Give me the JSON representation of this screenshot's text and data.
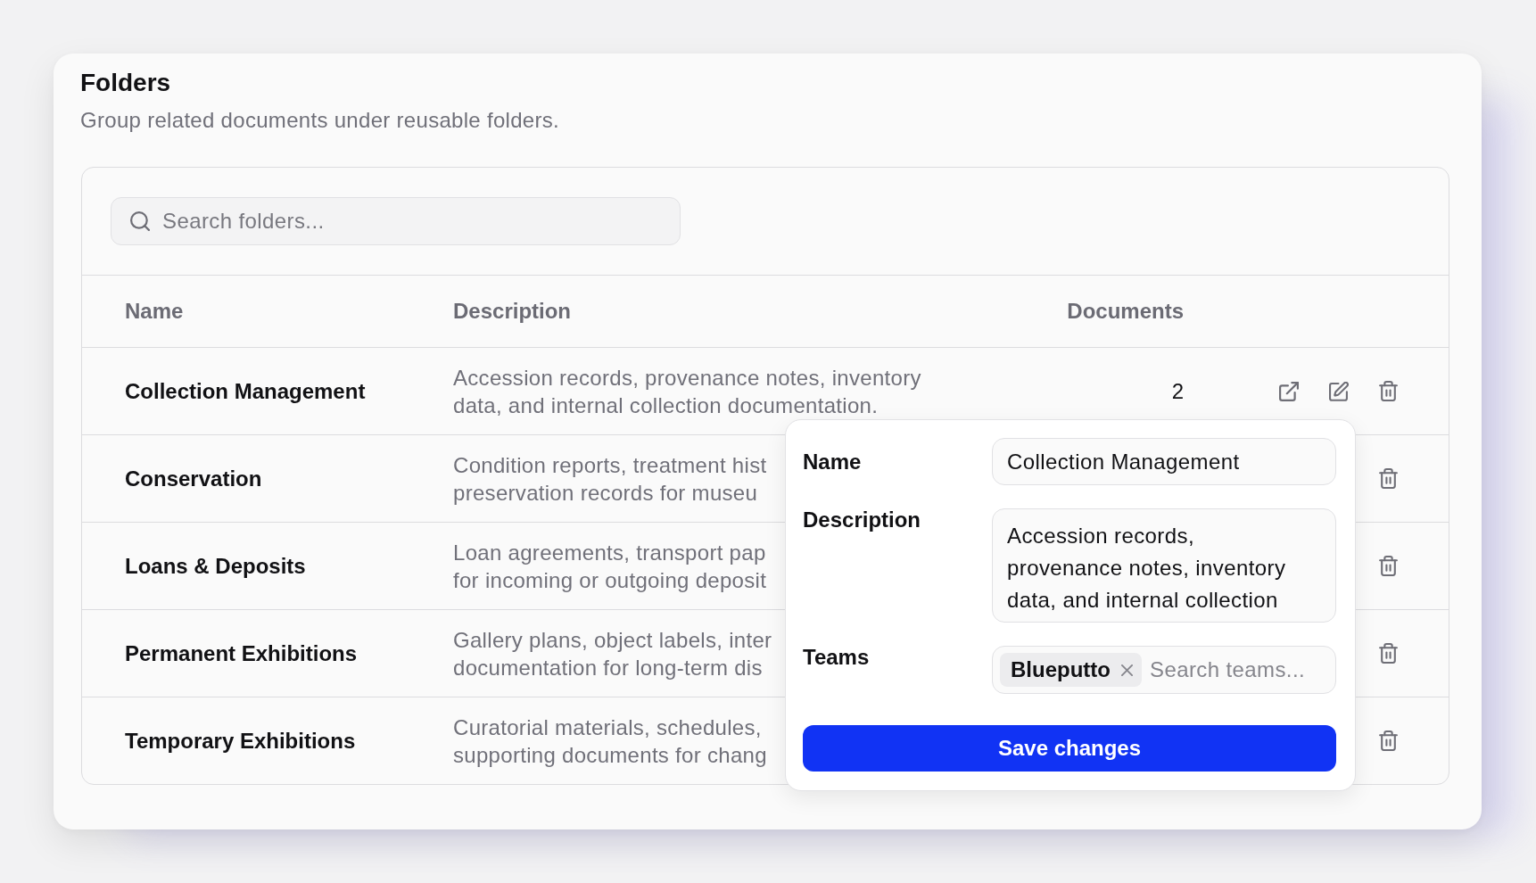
{
  "page": {
    "title": "Folders",
    "subtitle": "Group related documents under reusable folders."
  },
  "search": {
    "placeholder": "Search folders..."
  },
  "table": {
    "columns": [
      "Name",
      "Description",
      "Documents"
    ],
    "rows": [
      {
        "name": "Collection Management",
        "description": [
          "Accession records, provenance notes, inventory",
          "data, and internal collection documentation."
        ],
        "documents": "2",
        "actions": [
          {
            "kind": "open"
          },
          {
            "kind": "edit"
          },
          {
            "kind": "delete"
          }
        ]
      },
      {
        "name": "Conservation",
        "description": [
          "Condition reports, treatment hist",
          "preservation records for museu"
        ],
        "actions": [
          {
            "kind": "delete"
          }
        ]
      },
      {
        "name": "Loans & Deposits",
        "description": [
          "Loan agreements, transport pap",
          "for incoming or outgoing deposit"
        ],
        "actions": [
          {
            "kind": "delete"
          }
        ]
      },
      {
        "name": "Permanent Exhibitions",
        "description": [
          "Gallery plans, object labels, inter",
          "documentation for long-term dis"
        ],
        "actions": [
          {
            "kind": "delete"
          }
        ]
      },
      {
        "name": "Temporary Exhibitions",
        "description": [
          "Curatorial materials, schedules,",
          "supporting documents for chang"
        ],
        "actions": [
          {
            "kind": "delete"
          }
        ]
      }
    ]
  },
  "edit_popover": {
    "fields": [
      {
        "kind": "input",
        "label": "Name",
        "value": "Collection Management"
      },
      {
        "kind": "textarea",
        "label": "Description",
        "value": "Accession records, provenance notes, inventory data, and internal collection"
      },
      {
        "kind": "tags",
        "label": "Teams",
        "tags": [
          "Blueputto"
        ],
        "placeholder": "Search teams..."
      }
    ],
    "submit": "Save changes"
  }
}
